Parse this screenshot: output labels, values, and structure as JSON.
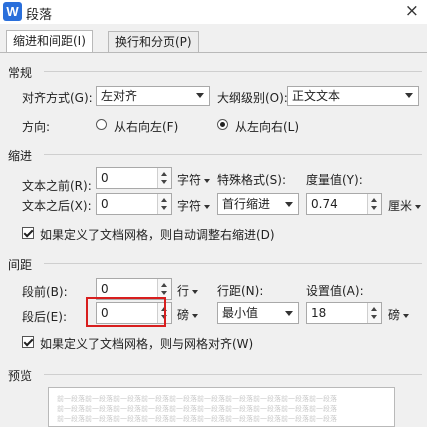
{
  "window": {
    "icon_letter": "W",
    "title": "段落",
    "close_glyph": "×"
  },
  "tabs": [
    "缩进和间距(I)",
    "换行和分页(P)"
  ],
  "general": {
    "heading": "常规",
    "alignment_label": "对齐方式(G):",
    "alignment_value": "左对齐",
    "outline_label": "大纲级别(O):",
    "outline_value": "正文文本",
    "direction_label": "方向:",
    "rtl_label": "从右向左(F)",
    "ltr_label": "从左向右(L)",
    "direction_selected": "ltr"
  },
  "indent": {
    "heading": "缩进",
    "before_label": "文本之前(R):",
    "before_value": "0",
    "before_unit": "字符",
    "after_label": "文本之后(X):",
    "after_value": "0",
    "after_unit": "字符",
    "special_label": "特殊格式(S):",
    "special_value": "首行缩进",
    "measure_label": "度量值(Y):",
    "measure_value": "0.74",
    "measure_unit": "厘米",
    "auto_adjust_label": "如果定义了文档网格，则自动调整右缩进(D)",
    "auto_adjust_checked": true
  },
  "spacing": {
    "heading": "间距",
    "before_label": "段前(B):",
    "before_value": "0",
    "before_unit": "行",
    "after_label": "段后(E):",
    "after_value": "0",
    "after_unit": "磅",
    "line_label": "行距(N):",
    "line_value": "最小值",
    "setting_label": "设置值(A):",
    "setting_value": "18",
    "setting_unit": "磅",
    "snap_grid_label": "如果定义了文档网格，则与网格对齐(W)",
    "snap_grid_checked": true
  },
  "preview": {
    "heading": "预览",
    "sample_text": "前一段落前一段落前一段落前一段落前一段落前一段落前一段落前一段落前一段落前一段落"
  },
  "colors": {
    "highlight": "#d81e1e",
    "icon_blue": "#2a6fdb"
  }
}
